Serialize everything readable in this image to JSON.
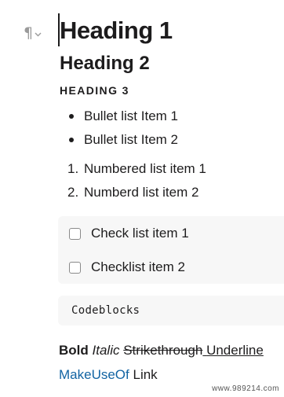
{
  "block_menu": {
    "icon": "pilcrow-icon",
    "glyph": "¶",
    "dropdown_icon": "chevron-down-icon"
  },
  "editor": {
    "heading1": "Heading 1",
    "heading2": "Heading 2",
    "heading3": "HEADING 3",
    "bullet_list": [
      "Bullet list Item 1",
      "Bullet list Item 2"
    ],
    "numbered_list": [
      {
        "number": "1.",
        "text": "Numbered list item 1"
      },
      {
        "number": "2.",
        "text": "Numberd list item 2"
      }
    ],
    "checklist": [
      {
        "text": "Check list item 1",
        "checked": false
      },
      {
        "text": "Checklist item 2",
        "checked": false
      }
    ],
    "codeblock": "Codeblocks",
    "formatting": {
      "bold": "Bold",
      "italic": "Italic",
      "strikethrough": "Strikethrough",
      "underline": "Underline"
    },
    "link_line": {
      "link_text": "MakeUseOf",
      "plain_text": "Link"
    }
  },
  "watermark": "www.989214.com",
  "colors": {
    "text": "#1d1c1d",
    "link": "#1264a3",
    "block_background": "#f7f7f7",
    "muted_icon": "#9a9a9a"
  }
}
